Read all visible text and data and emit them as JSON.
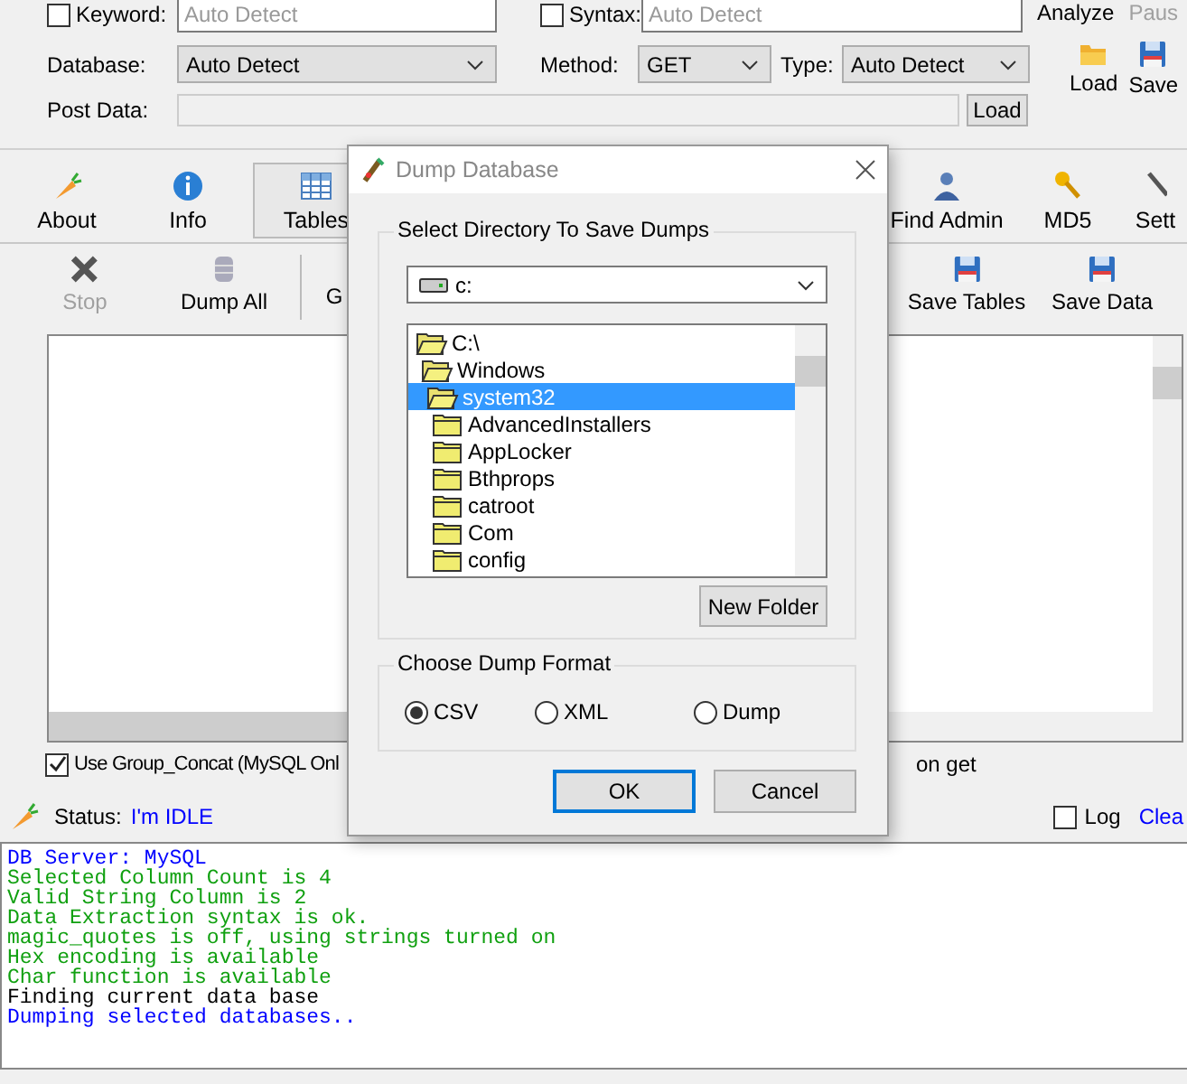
{
  "top": {
    "keyword": {
      "label": "Keyword:",
      "checked": false,
      "placeholder": "Auto Detect"
    },
    "syntax": {
      "label": "Syntax:",
      "checked": false,
      "placeholder": "Auto Detect"
    },
    "analyze": {
      "label": "Analyze",
      "disabled": false
    },
    "pause": {
      "label": "Paus",
      "disabled": true
    },
    "database": {
      "label": "Database:",
      "value": "Auto Detect"
    },
    "method": {
      "label": "Method:",
      "value": "GET"
    },
    "type": {
      "label": "Type:",
      "value": "Auto Detect"
    },
    "post_data": {
      "label": "Post Data:",
      "button": "Load"
    },
    "load": "Load",
    "save": "Save"
  },
  "tabs": [
    {
      "label": "About",
      "selected": false
    },
    {
      "label": "Info",
      "selected": false
    },
    {
      "label": "Tables",
      "selected": true
    },
    {
      "label": "Find Admin",
      "selected": false
    },
    {
      "label": "MD5",
      "selected": false
    },
    {
      "label": "Sett",
      "selected": false
    }
  ],
  "actions": [
    {
      "label": "Stop",
      "disabled": true
    },
    {
      "label": "Dump All",
      "disabled": false
    },
    {
      "label": "G",
      "disabled": false
    },
    {
      "label": "Save Tables",
      "disabled": false
    },
    {
      "label": "Save Data",
      "disabled": false
    }
  ],
  "options": {
    "group_concat": {
      "label": "Use Group_Concat (MySQL Onl",
      "checked": true
    },
    "tail": "on get"
  },
  "status": {
    "label": "Status:",
    "value": "I'm IDLE",
    "log": {
      "label": "Log",
      "checked": false
    },
    "clear": "Clea"
  },
  "log_lines": [
    {
      "text": "DB Server: MySQL",
      "color": "#0000ff"
    },
    {
      "text": "Selected Column Count is 4",
      "color": "#10a010"
    },
    {
      "text": "Valid String Column is 2",
      "color": "#10a010"
    },
    {
      "text": "Data Extraction syntax is ok.",
      "color": "#10a010"
    },
    {
      "text": "magic_quotes is off, using strings turned on",
      "color": "#10a010"
    },
    {
      "text": "Hex encoding is available",
      "color": "#10a010"
    },
    {
      "text": "Char function is available",
      "color": "#10a010"
    },
    {
      "text": "Finding current data base",
      "color": "#000000"
    },
    {
      "text": "Dumping selected databases..",
      "color": "#0000ff"
    }
  ],
  "dialog": {
    "title": "Dump Database",
    "directory_group": "Select Directory To Save Dumps",
    "drive": "c:",
    "folders": [
      {
        "name": "C:\\",
        "open": true,
        "selected": false,
        "children": [
          {
            "name": "Windows",
            "open": true,
            "selected": false,
            "children": [
              {
                "name": "system32",
                "open": true,
                "selected": true,
                "children": [
                  {
                    "name": "AdvancedInstallers",
                    "open": false,
                    "selected": false
                  },
                  {
                    "name": "AppLocker",
                    "open": false,
                    "selected": false
                  },
                  {
                    "name": "Bthprops",
                    "open": false,
                    "selected": false
                  },
                  {
                    "name": "catroot",
                    "open": false,
                    "selected": false
                  },
                  {
                    "name": "Com",
                    "open": false,
                    "selected": false
                  },
                  {
                    "name": "config",
                    "open": false,
                    "selected": false
                  }
                ]
              }
            ]
          }
        ]
      }
    ],
    "new_folder": "New Folder",
    "format_group": "Choose Dump Format",
    "formats": [
      {
        "label": "CSV",
        "selected": true
      },
      {
        "label": "XML",
        "selected": false
      },
      {
        "label": "Dump",
        "selected": false
      }
    ],
    "ok": "OK",
    "cancel": "Cancel"
  }
}
